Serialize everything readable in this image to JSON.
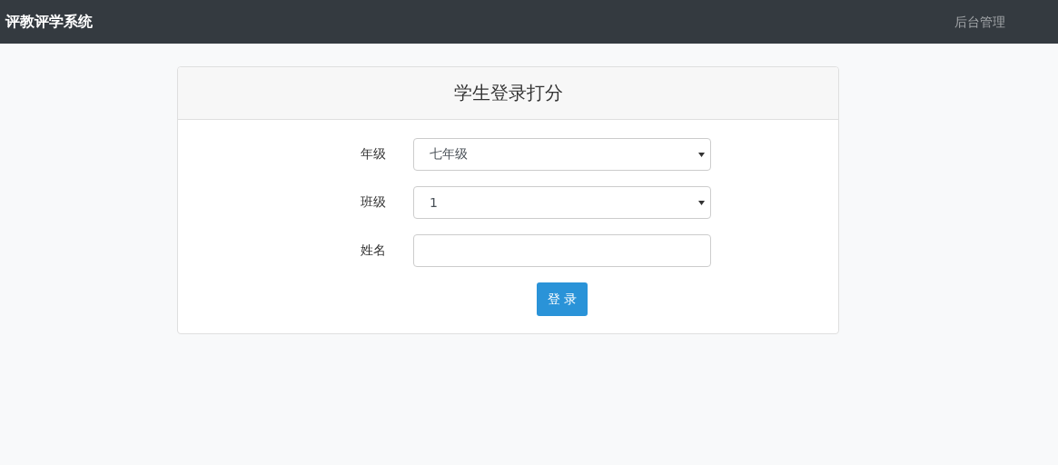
{
  "navbar": {
    "brand": "评教评学系统",
    "links": [
      {
        "label": "后台管理"
      }
    ]
  },
  "card": {
    "title": "学生登录打分",
    "fields": [
      {
        "label": "年级",
        "kind": "select",
        "value": "七年级"
      },
      {
        "label": "班级",
        "kind": "select",
        "value": "1"
      },
      {
        "label": "姓名",
        "kind": "text"
      }
    ],
    "submit": "登 录"
  }
}
